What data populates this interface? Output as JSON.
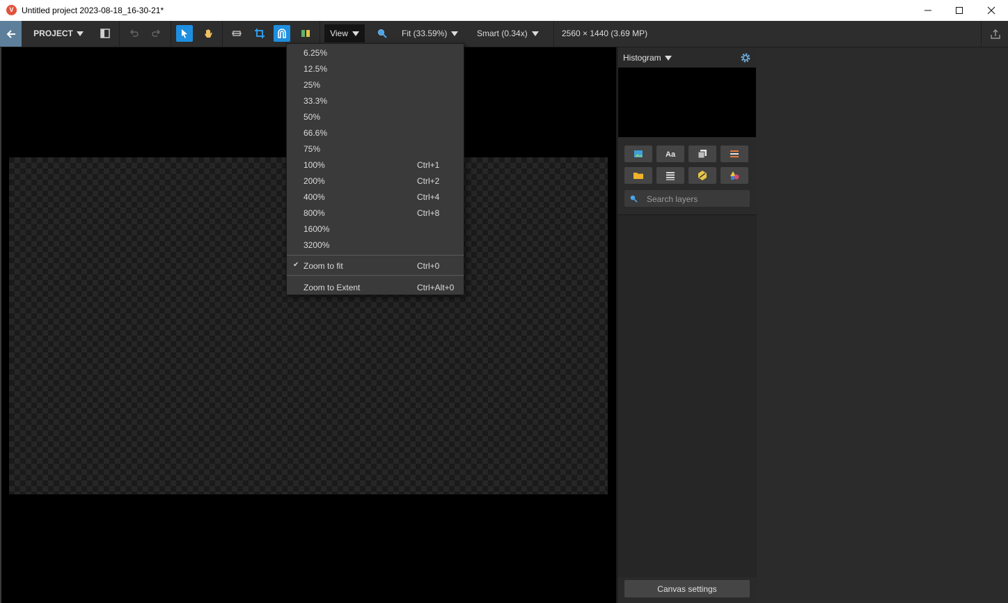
{
  "window": {
    "logo_letter": "V",
    "title": "Untitled project 2023-08-18_16-30-21*"
  },
  "toolbar": {
    "project_label": "PROJECT",
    "view_label": "View",
    "zoom_label": "Fit (33.59%)",
    "smart_label": "Smart (0.34x)",
    "dimensions": "2560 × 1440 (3.69 MP)"
  },
  "zoom_menu": {
    "items": [
      {
        "label": "6.25%",
        "shortcut": ""
      },
      {
        "label": "12.5%",
        "shortcut": ""
      },
      {
        "label": "25%",
        "shortcut": ""
      },
      {
        "label": "33.3%",
        "shortcut": ""
      },
      {
        "label": "50%",
        "shortcut": ""
      },
      {
        "label": "66.6%",
        "shortcut": ""
      },
      {
        "label": "75%",
        "shortcut": ""
      },
      {
        "label": "100%",
        "shortcut": "Ctrl+1"
      },
      {
        "label": "200%",
        "shortcut": "Ctrl+2"
      },
      {
        "label": "400%",
        "shortcut": "Ctrl+4"
      },
      {
        "label": "800%",
        "shortcut": "Ctrl+8"
      },
      {
        "label": "1600%",
        "shortcut": ""
      },
      {
        "label": "3200%",
        "shortcut": ""
      }
    ],
    "zoom_fit": {
      "label": "Zoom to fit",
      "shortcut": "Ctrl+0",
      "checked": true
    },
    "zoom_extent": {
      "label": "Zoom to Extent",
      "shortcut": "Ctrl+Alt+0"
    }
  },
  "panel": {
    "histogram_label": "Histogram",
    "search_placeholder": "Search layers",
    "canvas_settings_label": "Canvas settings"
  },
  "colors": {
    "accent": "#1e8fe0",
    "back_button": "#5d7f9b",
    "logo": "#e2533b"
  }
}
